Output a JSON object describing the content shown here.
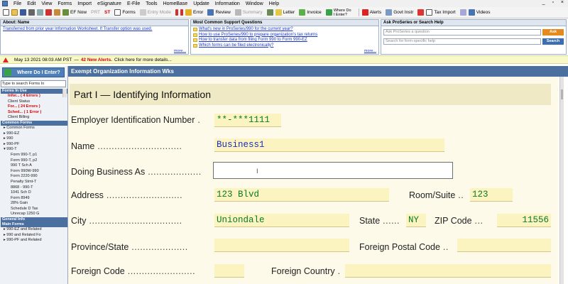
{
  "menu": {
    "items": [
      "File",
      "Edit",
      "View",
      "Forms",
      "Import",
      "eSignature",
      "E-File",
      "Tools",
      "HomeBase",
      "Update",
      "Information",
      "Window",
      "Help"
    ],
    "window_controls": "_ ▫ ×"
  },
  "toolbar": {
    "ef_now": "EF Now",
    "prt": "PRT",
    "st": "ST",
    "forms": "Forms",
    "entry_mode": "Entry Mode",
    "error": "Error",
    "review": "Review",
    "summary": "Summary",
    "letter": "Letter",
    "invoice": "Invoice",
    "where_do": "Where Do\nI Enter?",
    "alerts": "Alerts",
    "govt_instr": "Govt Instr",
    "tax_import": "Tax Import",
    "videos": "Videos"
  },
  "about_panel": {
    "title": "About: Name",
    "text": "Transferred from prior year Information Worksheet. If Transfer option was used.",
    "more": "more..."
  },
  "support_panel": {
    "title": "Most Common Support Questions",
    "questions": [
      "What's new in ProSeries/990 for the current year?",
      "How to use ProSeries/990 to prepare organization's tax returns",
      "How to transfer data from filing Form 990 to Form 990-EZ",
      "Which forms can be filed electronically?"
    ],
    "more": "more..."
  },
  "help_panel": {
    "title": "Ask ProSeries or Search Help",
    "ask_placeholder": "Ask ProSeries a question",
    "ask_button": "Ask",
    "search_placeholder": "Search for form-specific help",
    "search_button": "Search"
  },
  "alert_bar": {
    "timestamp": "May 13 2021 08:03 AM PST",
    "separator": "—",
    "new_alerts": "42 New Alerts.",
    "more": "Click here for more details..."
  },
  "sidebar": {
    "where_button": "Where Do I Enter?",
    "search_placeholder": "Type to search Forms In",
    "forms_in_use_header": "Forms In Use",
    "forms_in_use": [
      {
        "label": "Infor... ( 4 Errors )",
        "red": true
      },
      {
        "label": "Client Status",
        "red": false
      },
      {
        "label": "For... ( 24 Errors )",
        "red": true
      },
      {
        "label": "Sched... ( 1 Error )",
        "red": true
      },
      {
        "label": "Client Billing",
        "red": false
      }
    ],
    "common_forms_header": "Common Forms",
    "common_forms": [
      "▸ Common Forms",
      "▸ 990-EZ",
      "▸ 990",
      "▸ 990-PF",
      "▾ 990-T",
      "Form 990-T, p1",
      "Form 990-T, p2",
      "990 T Sch A",
      "Form 990W-990",
      "Form 2220-990",
      "Penalty Stmt-T",
      "8868 - 990-T",
      "1041 Sch D",
      "Form 8949",
      "28% Gain",
      "Schedule D Tax",
      "Unrecap 1250 G"
    ],
    "general_info_header": "General Info",
    "main_forms_header": "Main Forms",
    "main_forms": [
      "▸ 990-EZ and Related",
      "▸ 990 and Related Fo",
      "▸ 990-PF and Related"
    ]
  },
  "form": {
    "window_title": "Exempt Organization Information Wks",
    "part_title": "Part I — Identifying Information",
    "fields": {
      "ein_label": "Employer Identification Number",
      "ein_value": "**-***1111",
      "name_label": "Name",
      "name_value": "Business1",
      "dba_label": "Doing Business As",
      "dba_value": "",
      "address_label": "Address",
      "address_value": "123 Blvd",
      "room_label": "Room/Suite",
      "room_value": "123",
      "city_label": "City",
      "city_value": "Uniondale",
      "state_label": "State",
      "state_value": "NY",
      "zip_label": "ZIP Code",
      "zip_value": "11556",
      "province_label": "Province/State",
      "province_value": "",
      "foreign_postal_label": "Foreign Postal Code",
      "foreign_postal_value": "",
      "foreign_code_label": "Foreign Code",
      "foreign_code_value": "",
      "foreign_country_label": "Foreign Country",
      "foreign_country_value": ""
    }
  }
}
